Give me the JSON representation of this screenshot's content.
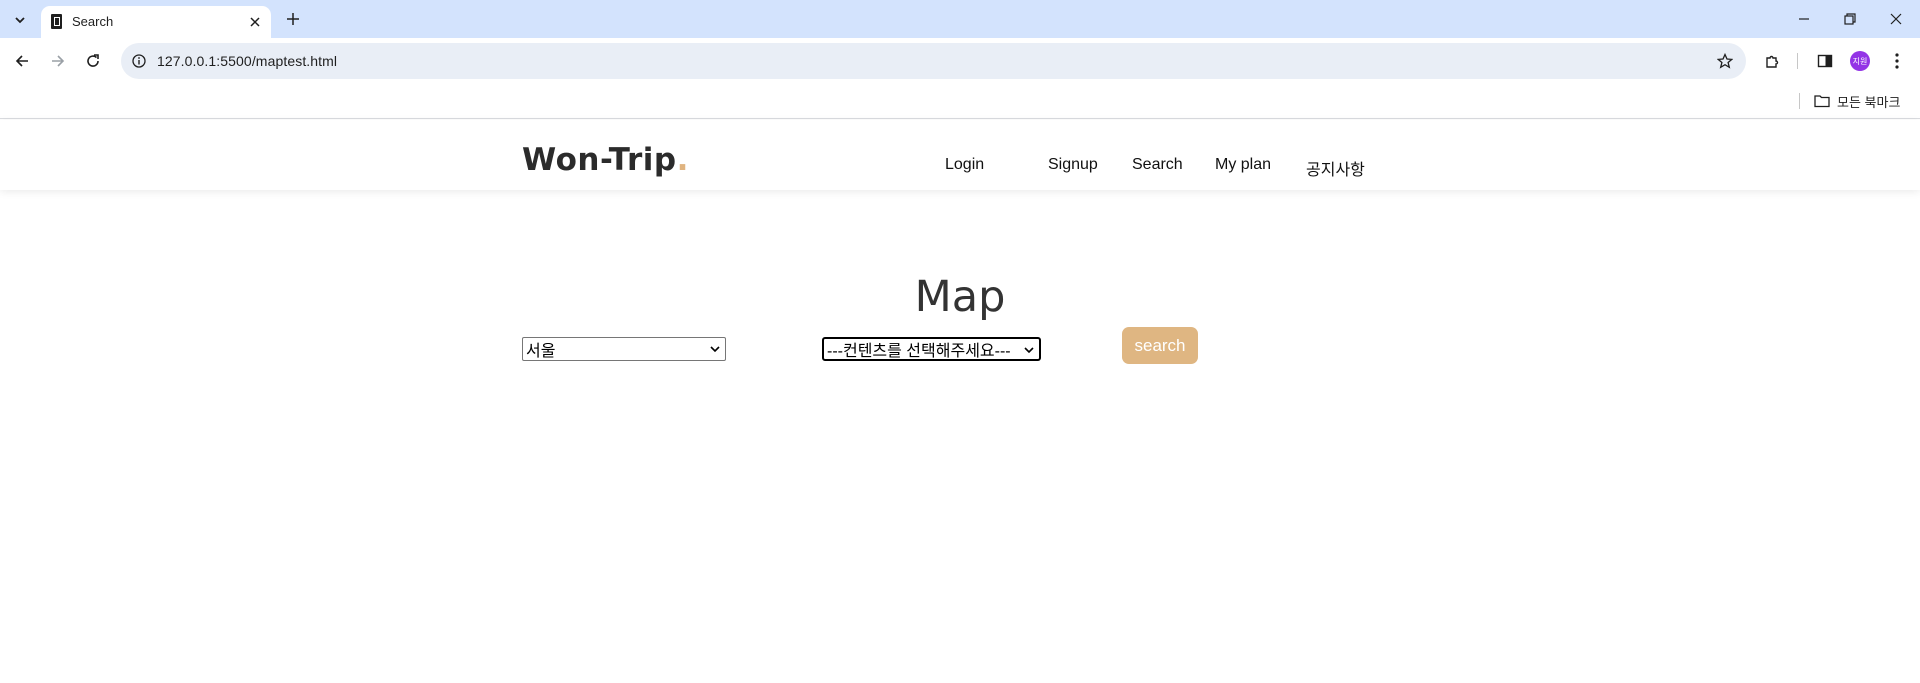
{
  "browser": {
    "tab_title": "Search",
    "url": "127.0.0.1:5500/maptest.html",
    "profile_initials": "지원",
    "bookmarks_label": "모든 북마크"
  },
  "site": {
    "logo_text": "Won-Trip",
    "logo_dot": ".",
    "logo_dot_color": "#e0b480",
    "nav": [
      {
        "label": "Login"
      },
      {
        "label": "Signup"
      },
      {
        "label": "Search"
      },
      {
        "label": "My plan"
      },
      {
        "label": "공지사항"
      }
    ]
  },
  "main": {
    "title": "Map",
    "region_select": {
      "selected": "서울"
    },
    "content_select": {
      "selected": "---컨텐츠를 선택해주세요---"
    },
    "search_button": {
      "label": "search",
      "color": "#dfb682"
    }
  }
}
